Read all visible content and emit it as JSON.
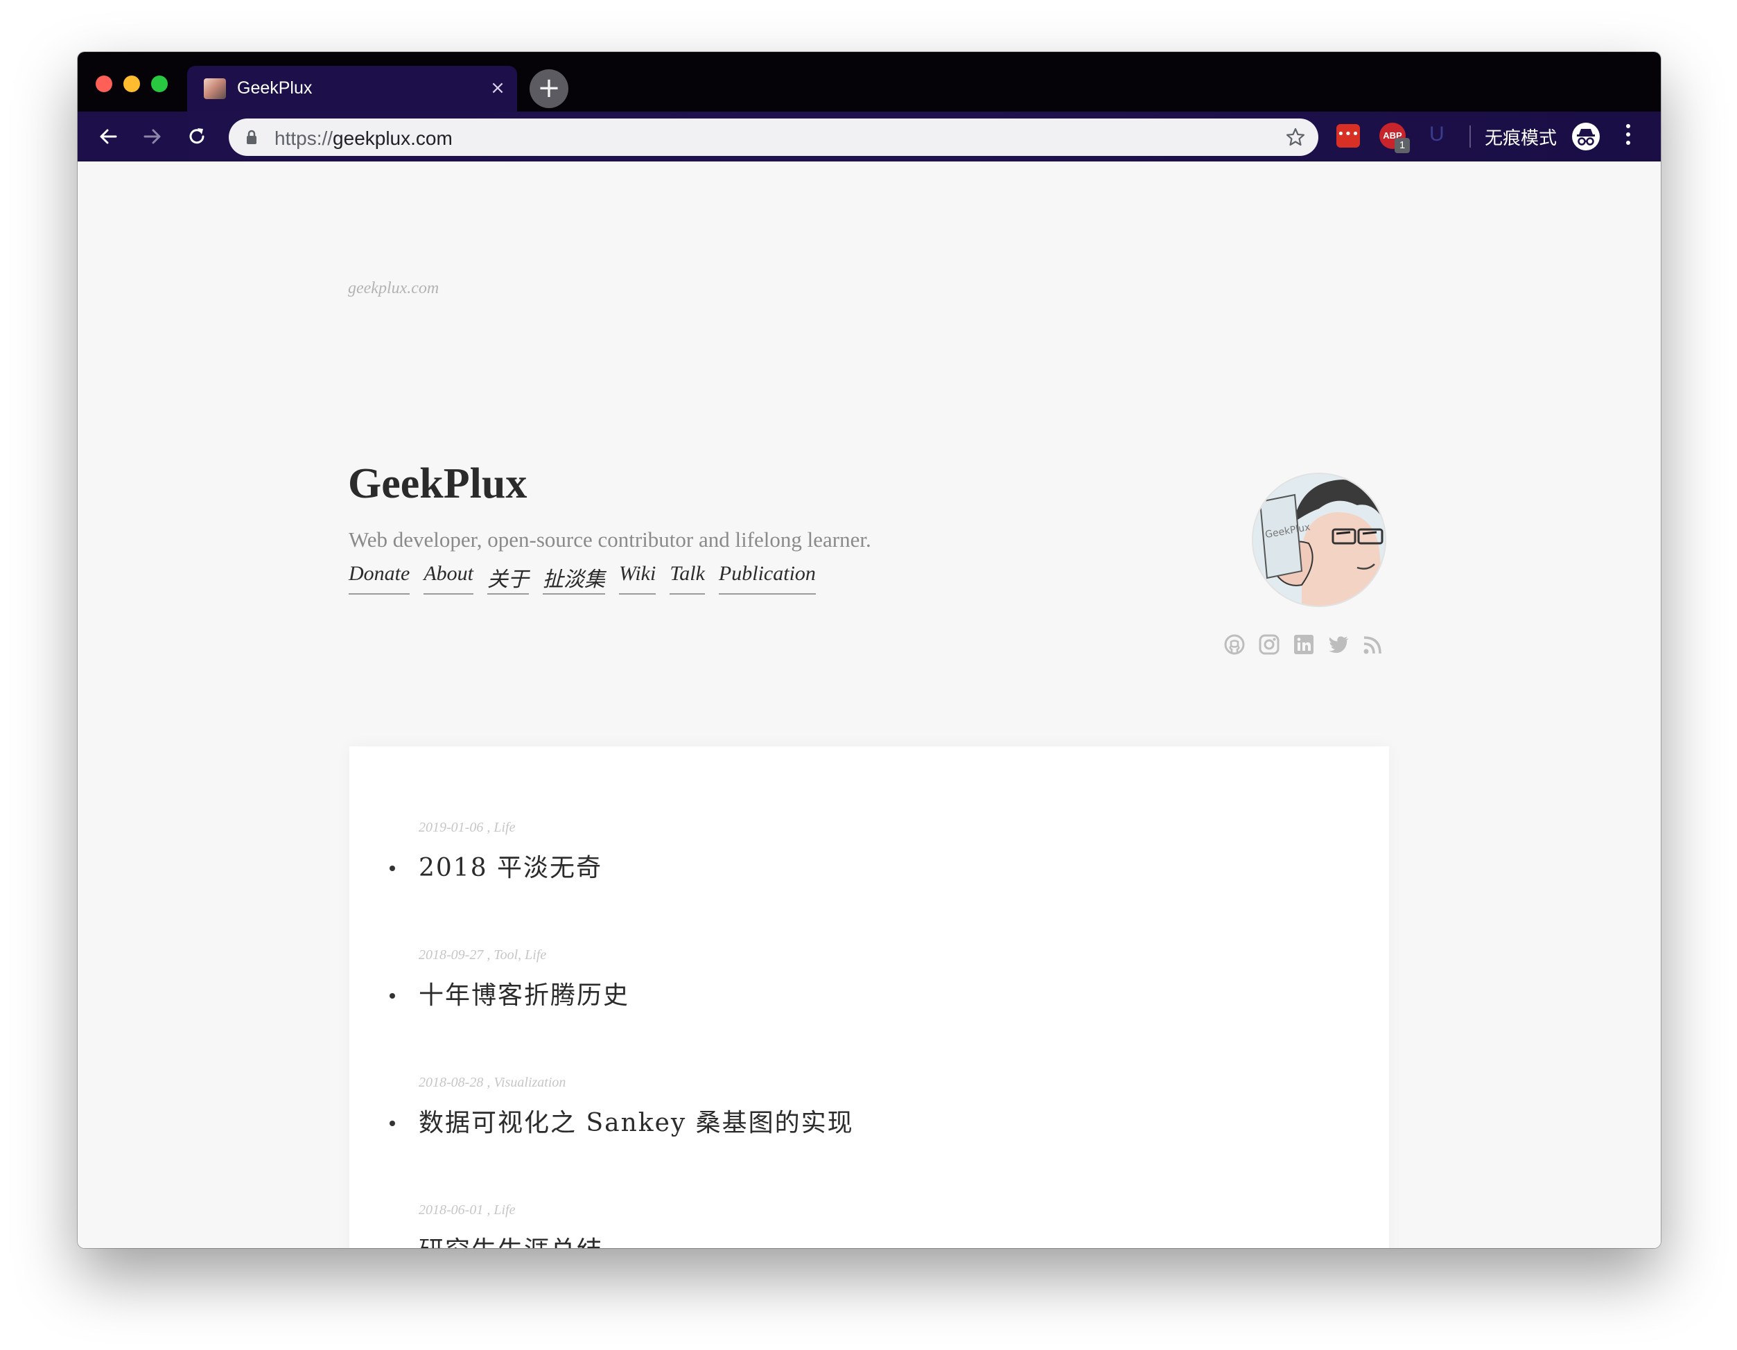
{
  "browser": {
    "tab_title": "GeekPlux",
    "tab_close": "×",
    "new_tab": "+",
    "url_scheme": "https://",
    "url_host": "geekplux.com",
    "ext_abp_label": "ABP",
    "ext_abp_badge": "1",
    "ext_u_label": "U",
    "incognito_label": "无痕模式"
  },
  "site": {
    "tag": "geekplux.com",
    "title": "GeekPlux",
    "tagline": "Web developer, open-source contributor and lifelong learner.",
    "nav_links": [
      "Donate",
      "About",
      "关于",
      "扯淡集",
      "Wiki",
      "Talk",
      "Publication"
    ],
    "social_icons": [
      "github-icon",
      "instagram-icon",
      "linkedin-icon",
      "twitter-icon",
      "rss-icon"
    ]
  },
  "posts": [
    {
      "date": "2019-01-06",
      "tags": "Life",
      "title": "2018 平淡无奇"
    },
    {
      "date": "2018-09-27",
      "tags": "Tool, Life",
      "title": "十年博客折腾历史"
    },
    {
      "date": "2018-08-28",
      "tags": "Visualization",
      "title": "数据可视化之 Sankey 桑基图的实现"
    },
    {
      "date": "2018-06-01",
      "tags": "Life",
      "title": "研究生生涯总结"
    }
  ],
  "colors": {
    "tab_bar": "#050308",
    "toolbar": "#1c0f4a",
    "page_bg": "#f7f7f7",
    "card_bg": "#ffffff",
    "text": "#2b2b2b",
    "muted": "#8a8a8a"
  }
}
